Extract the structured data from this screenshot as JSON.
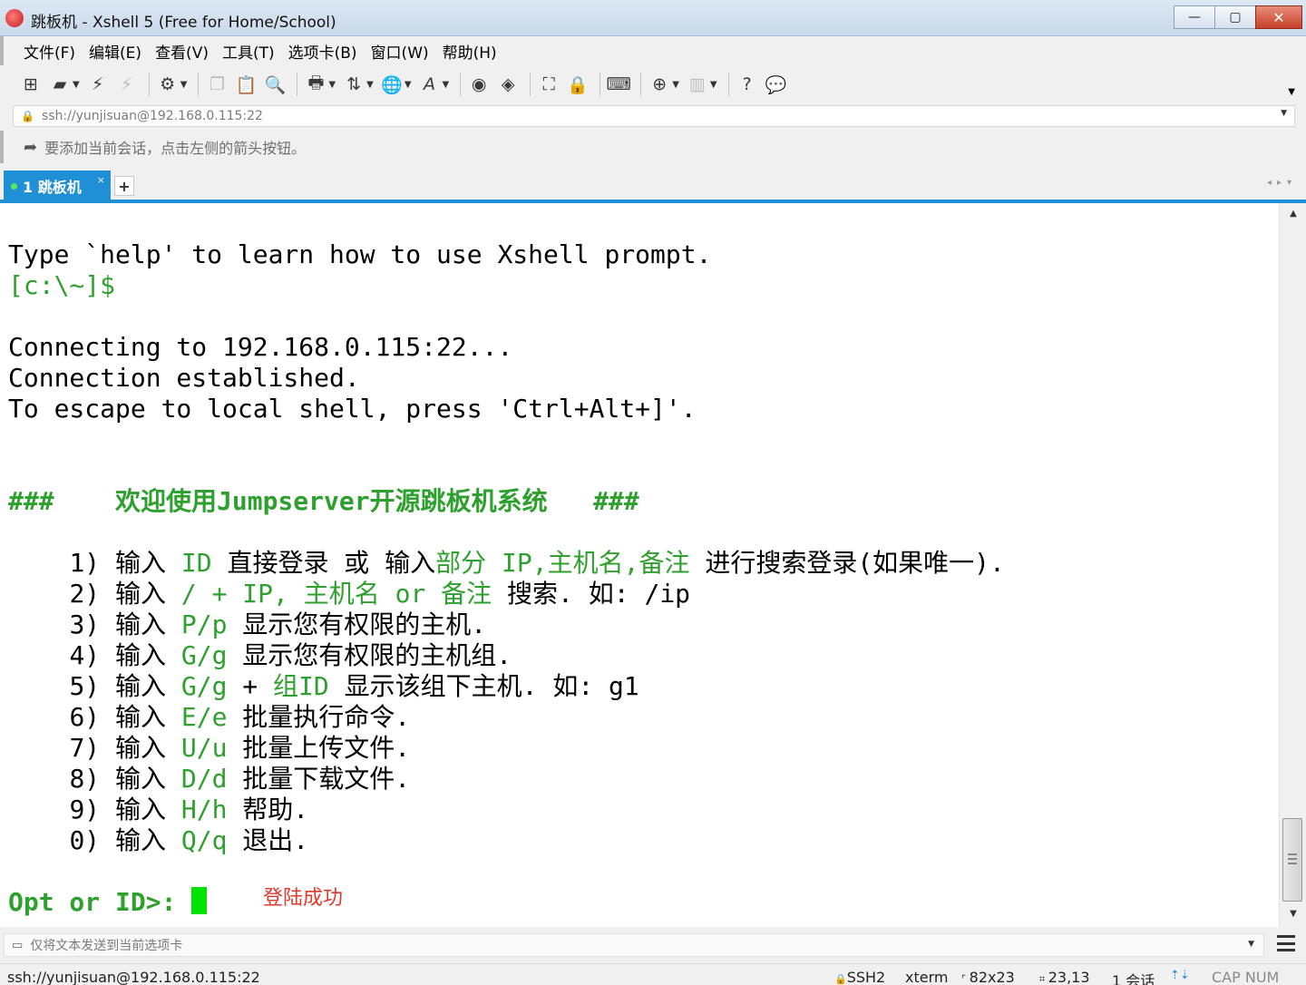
{
  "window": {
    "title": "跳板机 - Xshell 5 (Free for Home/School)",
    "buttons": {
      "minimize": "—",
      "maximize": "▢",
      "close": "✕"
    }
  },
  "menu": [
    "文件(F)",
    "编辑(E)",
    "查看(V)",
    "工具(T)",
    "选项卡(B)",
    "窗口(W)",
    "帮助(H)"
  ],
  "address": {
    "lock_icon": "🔒",
    "url": "ssh://yunjisuan@192.168.0.115:22"
  },
  "hint": {
    "text": "要添加当前会话，点击左侧的箭头按钮。"
  },
  "tabs": [
    {
      "label": "1 跳板机",
      "close": "×"
    }
  ],
  "terminal": {
    "l1": "Type `help' to learn how to use Xshell prompt.",
    "prompt": "[c:\\~]$",
    "conn1": "Connecting to 192.168.0.115:22...",
    "conn2": "Connection established.",
    "conn3": "To escape to local shell, press 'Ctrl+Alt+]'.",
    "banner": "###    欢迎使用Jumpserver开源跳板机系统   ###",
    "menu_items": {
      "m1": {
        "num": "1) 输入 ",
        "a": "ID",
        "b": " 直接登录 或 输入",
        "c": "部分 IP,主机名,备注",
        "d": " 进行搜索登录(如果唯一)."
      },
      "m2": {
        "num": "2) 输入 ",
        "a": "/ + IP, 主机名 or 备注",
        "b": " 搜索. 如: /ip"
      },
      "m3": {
        "num": "3) 输入 ",
        "a": "P/p",
        "b": " 显示您有权限的主机."
      },
      "m4": {
        "num": "4) 输入 ",
        "a": "G/g",
        "b": " 显示您有权限的主机组."
      },
      "m5": {
        "num": "5) 输入 ",
        "a": "G/g",
        "b": " + ",
        "c": "组ID",
        "d": " 显示该组下主机. 如: g1"
      },
      "m6": {
        "num": "6) 输入 ",
        "a": "E/e",
        "b": " 批量执行命令."
      },
      "m7": {
        "num": "7) 输入 ",
        "a": "U/u",
        "b": " 批量上传文件."
      },
      "m8": {
        "num": "8) 输入 ",
        "a": "D/d",
        "b": " 批量下载文件."
      },
      "m9": {
        "num": "9) 输入 ",
        "a": "H/h",
        "b": " 帮助."
      },
      "m0": {
        "num": "0) 输入 ",
        "a": "Q/q",
        "b": " 退出."
      }
    },
    "opt_prompt": "Opt or ID>: ",
    "annotation": "登陆成功"
  },
  "compose": {
    "placeholder": "仅将文本发送到当前选项卡"
  },
  "status": {
    "address": "ssh://yunjisuan@192.168.0.115:22",
    "protocol": "SSH2",
    "term": "xterm",
    "size": "82x23",
    "cursor": "23,13",
    "sessions": "1 会话",
    "caps": "CAP NUM"
  },
  "colors": {
    "accent": "#1f8fd6",
    "terminal_green": "#2ea02e",
    "cursor_green": "#00e200",
    "annotation_red": "#e0392b"
  },
  "icons": [
    "new-session-icon",
    "open-folder-icon",
    "connect-icon",
    "disconnect-icon",
    "properties-icon",
    "copy-icon",
    "paste-icon",
    "find-icon",
    "print-icon",
    "transfer-icon",
    "globe-icon",
    "font-icon",
    "xftp-icon",
    "xmanager-icon",
    "fullscreen-icon",
    "lock-icon",
    "keyboard-icon",
    "add-icon",
    "layout-icon",
    "help-icon",
    "chat-icon"
  ]
}
